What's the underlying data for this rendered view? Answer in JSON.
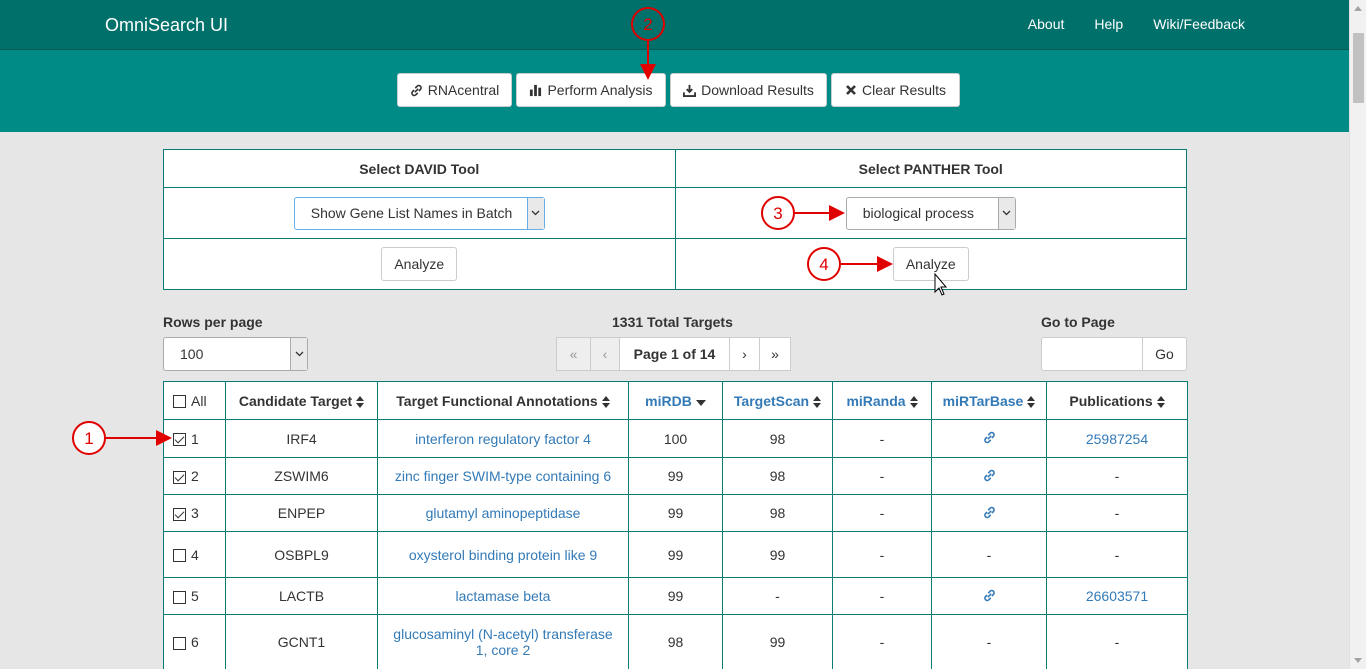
{
  "navbar": {
    "brand": "OmniSearch UI",
    "links": [
      "About",
      "Help",
      "Wiki/Feedback"
    ]
  },
  "toolbar": {
    "rnacentral": "RNAcentral",
    "perform_analysis": "Perform Analysis",
    "download_results": "Download Results",
    "clear_results": "Clear Results"
  },
  "tools": {
    "david_header": "Select DAVID Tool",
    "panther_header": "Select PANTHER Tool",
    "david_selected": "Show Gene List Names in Batch",
    "panther_selected": "biological process",
    "analyze_label": "Analyze"
  },
  "controls": {
    "rows_per_page_label": "Rows per page",
    "rows_per_page_value": "100",
    "total_targets": "1331 Total Targets",
    "page_info": "Page 1 of 14",
    "first": "«",
    "prev": "‹",
    "next": "›",
    "last": "»",
    "go_to_page_label": "Go to Page",
    "go_label": "Go",
    "go_input_value": ""
  },
  "table": {
    "headers": {
      "all": "All",
      "candidate": "Candidate Target",
      "annotations": "Target Functional Annotations",
      "mirdb": "miRDB",
      "targetscan": "TargetScan",
      "miranda": "miRanda",
      "mirtarbase": "miRTarBase",
      "publications": "Publications"
    },
    "rows": [
      {
        "n": "1",
        "checked": true,
        "target": "IRF4",
        "annotation": "interferon regulatory factor 4",
        "mirdb": "100",
        "targetscan": "98",
        "miranda": "-",
        "mirtarbase": "link",
        "publication": "25987254"
      },
      {
        "n": "2",
        "checked": true,
        "target": "ZSWIM6",
        "annotation": "zinc finger SWIM-type containing 6",
        "mirdb": "99",
        "targetscan": "98",
        "miranda": "-",
        "mirtarbase": "link",
        "publication": "-"
      },
      {
        "n": "3",
        "checked": true,
        "target": "ENPEP",
        "annotation": "glutamyl aminopeptidase",
        "mirdb": "99",
        "targetscan": "98",
        "miranda": "-",
        "mirtarbase": "link",
        "publication": "-"
      },
      {
        "n": "4",
        "checked": false,
        "target": "OSBPL9",
        "annotation": "oxysterol binding protein like 9",
        "mirdb": "99",
        "targetscan": "99",
        "miranda": "-",
        "mirtarbase": "-",
        "publication": "-"
      },
      {
        "n": "5",
        "checked": false,
        "target": "LACTB",
        "annotation": "lactamase beta",
        "mirdb": "99",
        "targetscan": "-",
        "miranda": "-",
        "mirtarbase": "link",
        "publication": "26603571"
      },
      {
        "n": "6",
        "checked": false,
        "target": "GCNT1",
        "annotation": "glucosaminyl (N-acetyl) transferase 1, core 2",
        "mirdb": "98",
        "targetscan": "99",
        "miranda": "-",
        "mirtarbase": "-",
        "publication": "-"
      }
    ]
  },
  "annotations": {
    "marker1": "1",
    "marker2": "2",
    "marker3": "3",
    "marker4": "4",
    "color": "#e00000"
  },
  "colors": {
    "navbar": "#00706b",
    "band": "#008b86",
    "link": "#337ab7",
    "border": "#0b7b76"
  }
}
